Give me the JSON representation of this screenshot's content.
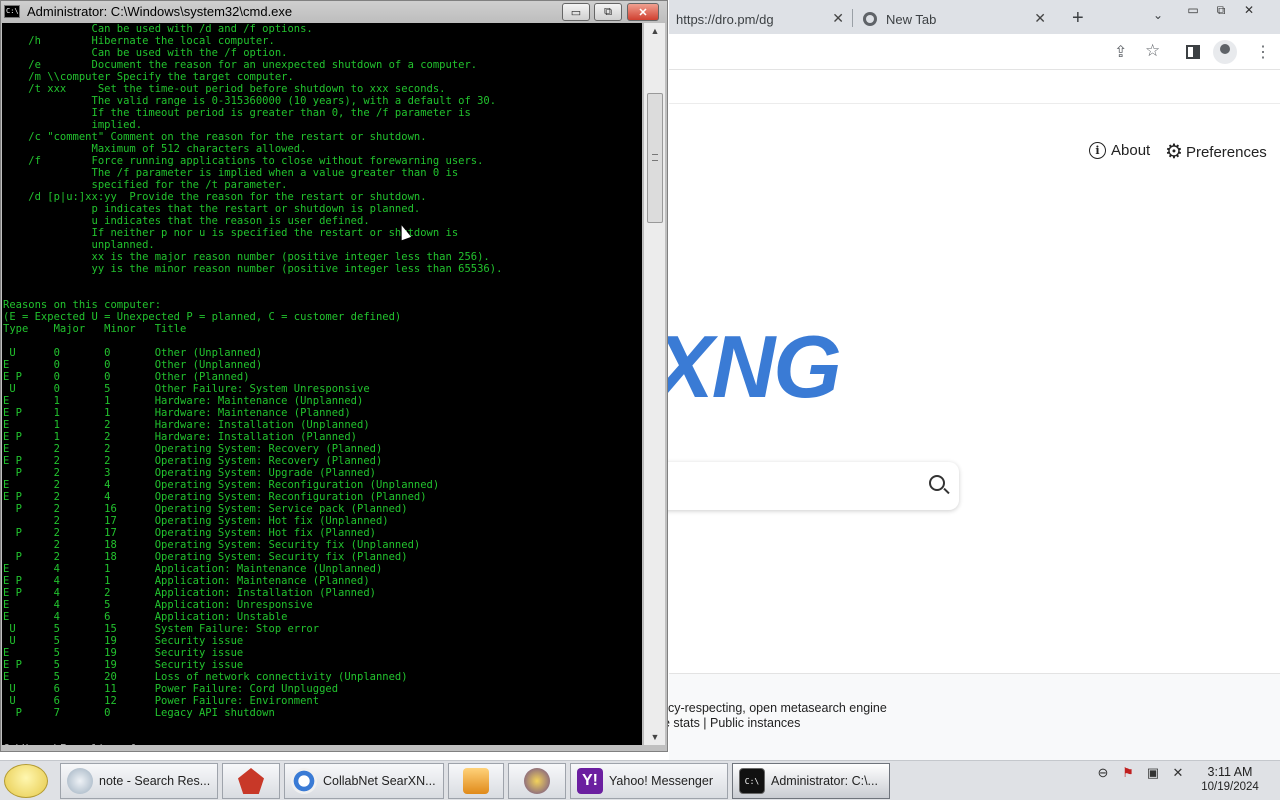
{
  "browser": {
    "tabs": [
      {
        "title": "https://dro.pm/dg",
        "close": "✕"
      },
      {
        "title": "New Tab",
        "close": "✕"
      }
    ],
    "new_tab": "+",
    "tab_search": "⌄",
    "window_controls": [
      "▭",
      "⧉",
      "✕"
    ],
    "toolbar_icons": [
      "share-icon",
      "star-icon",
      "side-panel-icon",
      "profile-icon",
      "menu-icon"
    ],
    "star_glyph": "☆",
    "share_glyph": "⇪",
    "menu_glyph": "⋮",
    "page": {
      "about": "About",
      "about_icon": "i",
      "preferences": "Preferences",
      "preferences_icon": "⚙",
      "logo": "XNG",
      "logo_color": "#3a7bd5",
      "footer_desc": "acy-respecting, open metasearch engine",
      "footer_links": "e stats | Public instances"
    }
  },
  "cmd": {
    "title": "Administrator: C:\\Windows\\system32\\cmd.exe",
    "icon_text": "C:\\",
    "buttons": {
      "minimize": "▭",
      "maximize": "⧉",
      "close": "✕"
    },
    "text_color": "#22c32e",
    "lines": [
      "              Can be used with /d and /f options.",
      "    /h        Hibernate the local computer.",
      "              Can be used with the /f option.",
      "    /e        Document the reason for an unexpected shutdown of a computer.",
      "    /m \\\\computer Specify the target computer.",
      "    /t xxx     Set the time-out period before shutdown to xxx seconds.",
      "              The valid range is 0-315360000 (10 years), with a default of 30.",
      "              If the timeout period is greater than 0, the /f parameter is",
      "              implied.",
      "    /c \"comment\" Comment on the reason for the restart or shutdown.",
      "              Maximum of 512 characters allowed.",
      "    /f        Force running applications to close without forewarning users.",
      "              The /f parameter is implied when a value greater than 0 is",
      "              specified for the /t parameter.",
      "    /d [p|u:]xx:yy  Provide the reason for the restart or shutdown.",
      "              p indicates that the restart or shutdown is planned.",
      "              u indicates that the reason is user defined.",
      "              If neither p nor u is specified the restart or shutdown is",
      "              unplanned.",
      "              xx is the major reason number (positive integer less than 256).",
      "              yy is the minor reason number (positive integer less than 65536).",
      "",
      "",
      "Reasons on this computer:",
      "(E = Expected U = Unexpected P = planned, C = customer defined)",
      "Type    Major   Minor   Title",
      "",
      " U      0       0       Other (Unplanned)",
      "E       0       0       Other (Unplanned)",
      "E P     0       0       Other (Planned)",
      " U      0       5       Other Failure: System Unresponsive",
      "E       1       1       Hardware: Maintenance (Unplanned)",
      "E P     1       1       Hardware: Maintenance (Planned)",
      "E       1       2       Hardware: Installation (Unplanned)",
      "E P     1       2       Hardware: Installation (Planned)",
      "E       2       2       Operating System: Recovery (Planned)",
      "E P     2       2       Operating System: Recovery (Planned)",
      "  P     2       3       Operating System: Upgrade (Planned)",
      "E       2       4       Operating System: Reconfiguration (Unplanned)",
      "E P     2       4       Operating System: Reconfiguration (Planned)",
      "  P     2       16      Operating System: Service pack (Planned)",
      "        2       17      Operating System: Hot fix (Unplanned)",
      "  P     2       17      Operating System: Hot fix (Planned)",
      "        2       18      Operating System: Security fix (Unplanned)",
      "  P     2       18      Operating System: Security fix (Planned)",
      "E       4       1       Application: Maintenance (Unplanned)",
      "E P     4       1       Application: Maintenance (Planned)",
      "E P     4       2       Application: Installation (Planned)",
      "E       4       5       Application: Unresponsive",
      "E       4       6       Application: Unstable",
      " U      5       15      System Failure: Stop error",
      " U      5       19      Security issue",
      "E       5       19      Security issue",
      "E P     5       19      Security issue",
      "E       5       20      Loss of network connectivity (Unplanned)",
      " U      6       11      Power Failure: Cord Unplugged",
      " U      6       12      Power Failure: Environment",
      "  P     7       0       Legacy API shutdown",
      "",
      ""
    ],
    "prompt": "C:\\Users\\Fpe oliver fan>",
    "scroll_up": "▲",
    "scroll_down": "▼"
  },
  "taskbar": {
    "tasks": [
      {
        "label": "note - Search Res...",
        "icon": "note-search-icon"
      },
      {
        "label": "",
        "icon": "red-app-icon"
      },
      {
        "label": "CollabNet SearXN...",
        "icon": "browser-icon"
      },
      {
        "label": "",
        "icon": "media-player-icon"
      },
      {
        "label": "",
        "icon": "messenger-icon"
      },
      {
        "label": "Yahoo! Messenger",
        "icon": "yahoo-messenger-icon",
        "glyph": "Y!"
      },
      {
        "label": "Administrator: C:\\...",
        "icon": "cmd-icon",
        "glyph": "C:\\"
      }
    ],
    "tray_icons": [
      "⊖",
      "⚑",
      "▣",
      "✕"
    ],
    "clock": {
      "time": "3:11 AM",
      "date": "10/19/2024"
    }
  }
}
